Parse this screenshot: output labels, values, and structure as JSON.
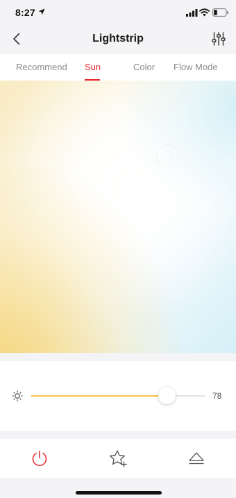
{
  "status_bar": {
    "time": "8:27",
    "icons": [
      "location-arrow-icon",
      "cellular-signal-icon",
      "wifi-icon",
      "battery-icon"
    ]
  },
  "nav": {
    "title": "Lightstrip",
    "back_icon": "chevron-left-icon",
    "settings_icon": "sliders-icon"
  },
  "tabs": [
    {
      "label": "Recommend",
      "active": false
    },
    {
      "label": "Sun",
      "active": true
    },
    {
      "label": "Color",
      "active": false
    },
    {
      "label": "Flow Mode",
      "active": false
    }
  ],
  "brightness": {
    "icon": "sun-icon",
    "value": 78,
    "value_label": "78",
    "max": 100
  },
  "bottom_bar": {
    "items": [
      "power-icon",
      "favorite-add-icon",
      "eject-icon"
    ]
  },
  "colors": {
    "accent": "#e8212c",
    "slider_fill": "#f5c044",
    "warm": "#f3d071",
    "cool": "#d6f0f8"
  }
}
